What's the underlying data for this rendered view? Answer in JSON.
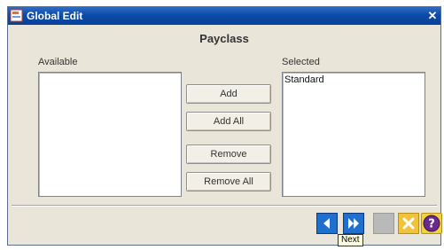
{
  "window": {
    "title": "Global Edit"
  },
  "heading": "Payclass",
  "available": {
    "label": "Available",
    "items": []
  },
  "selected": {
    "label": "Selected",
    "items": [
      "Standard"
    ]
  },
  "buttons": {
    "add": "Add",
    "add_all": "Add All",
    "remove": "Remove",
    "remove_all": "Remove All"
  },
  "tooltip": {
    "text": "Next"
  },
  "colors": {
    "title_bar": "#0b4ba8",
    "nav_blue": "#1f6fce",
    "cancel_yellow": "#f2c23a",
    "help_purple": "#6a2a8c"
  }
}
